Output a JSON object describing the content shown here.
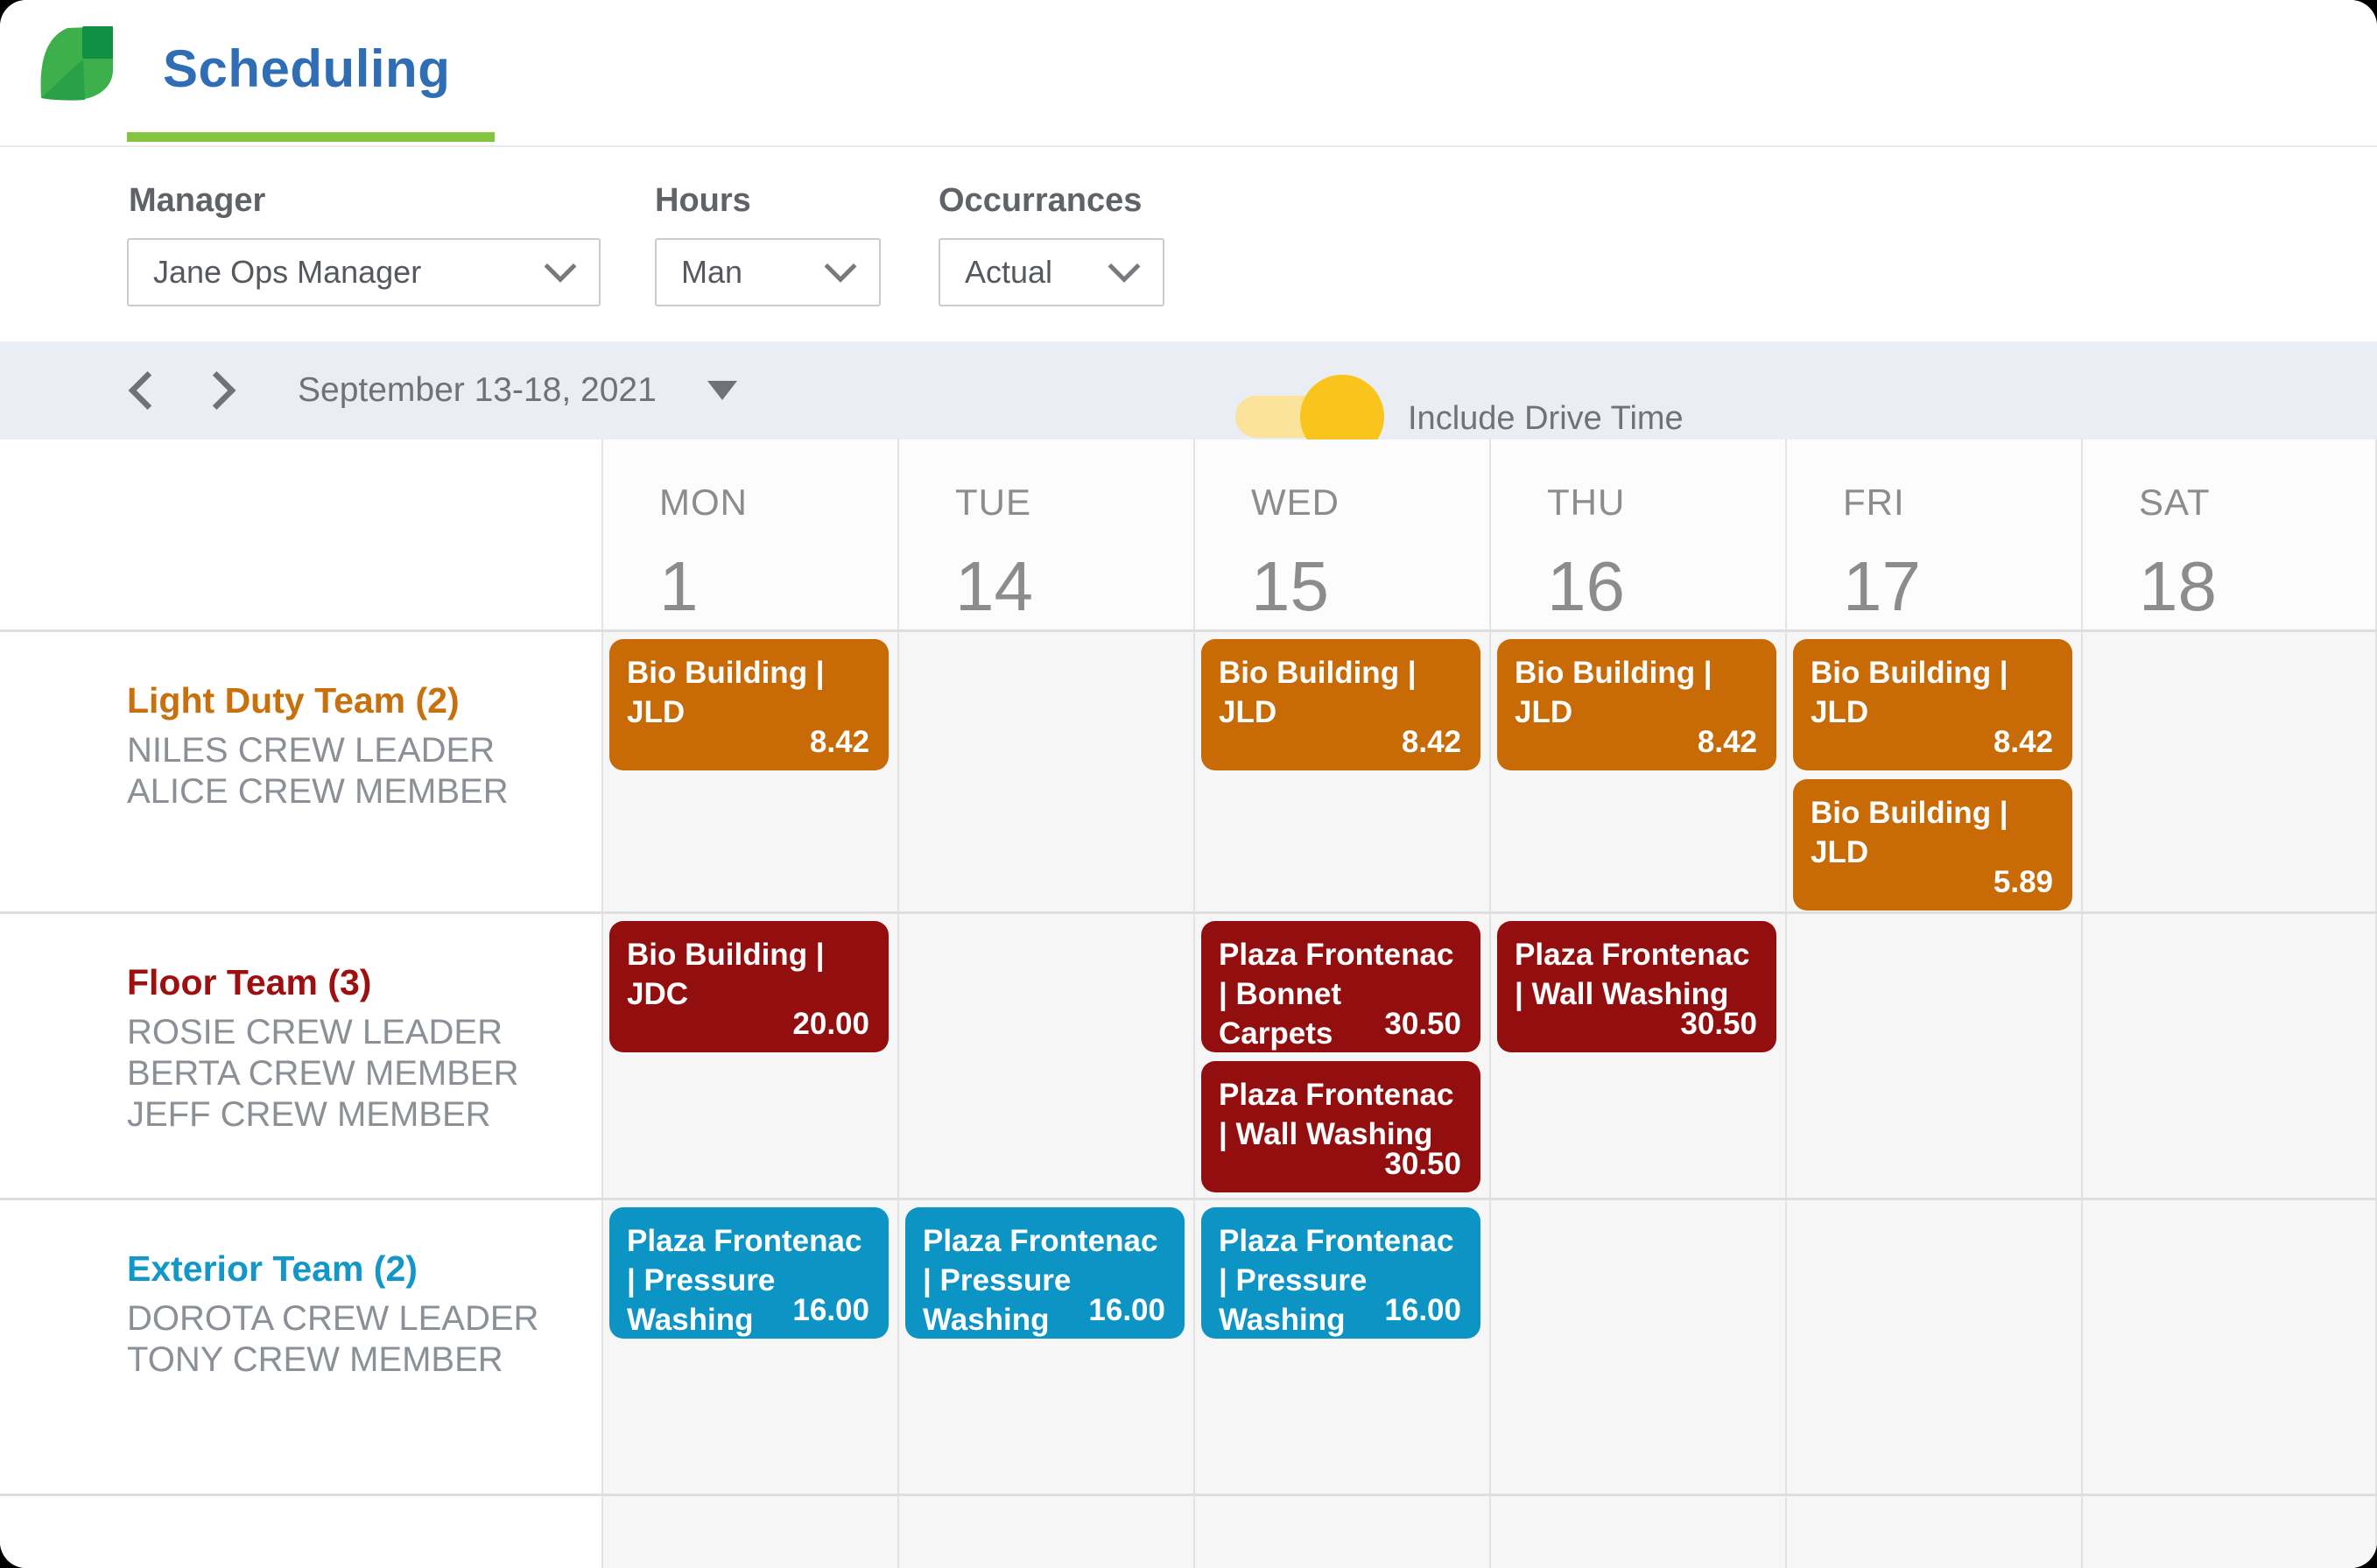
{
  "app": {
    "title": "Scheduling"
  },
  "filters": {
    "manager": {
      "label": "Manager",
      "value": "Jane Ops Manager"
    },
    "hours": {
      "label": "Hours",
      "value": "Man"
    },
    "occurrences": {
      "label": "Occurrances",
      "value": "Actual"
    },
    "drive_time": {
      "label": "Include Drive Time",
      "enabled": true
    }
  },
  "week_nav": {
    "range_label": "September 13-18, 2021"
  },
  "calendar": {
    "days": [
      {
        "name": "MON",
        "number": "1"
      },
      {
        "name": "TUE",
        "number": "14"
      },
      {
        "name": "WED",
        "number": "15"
      },
      {
        "name": "THU",
        "number": "16"
      },
      {
        "name": "FRI",
        "number": "17"
      },
      {
        "name": "SAT",
        "number": "18"
      }
    ],
    "teams": [
      {
        "name": "Light Duty Team (2)",
        "name_color": "#C8700C",
        "event_color": "#C86A06",
        "members": [
          "NILES CREW LEADER",
          "ALICE CREW MEMBER"
        ]
      },
      {
        "name": "Floor Team (3)",
        "name_color": "#9E1010",
        "event_color": "#930F0F",
        "members": [
          "ROSIE CREW LEADER",
          "BERTA CREW MEMBER",
          "JEFF CREW MEMBER"
        ]
      },
      {
        "name": "Exterior Team (2)",
        "name_color": "#1396C8",
        "event_color": "#0C94C4",
        "members": [
          "DOROTA CREW LEADER",
          "TONY CREW MEMBER"
        ]
      }
    ],
    "events": [
      {
        "team": 0,
        "day": 0,
        "slot": 0,
        "title": "Bio Building | JLD",
        "value": "8.42"
      },
      {
        "team": 0,
        "day": 2,
        "slot": 0,
        "title": "Bio Building | JLD",
        "value": "8.42"
      },
      {
        "team": 0,
        "day": 3,
        "slot": 0,
        "title": "Bio Building | JLD",
        "value": "8.42"
      },
      {
        "team": 0,
        "day": 4,
        "slot": 0,
        "title": "Bio Building | JLD",
        "value": "8.42"
      },
      {
        "team": 0,
        "day": 4,
        "slot": 1,
        "title": "Bio Building | JLD",
        "value": "5.89"
      },
      {
        "team": 1,
        "day": 0,
        "slot": 0,
        "title": "Bio Building | JDC",
        "value": "20.00"
      },
      {
        "team": 1,
        "day": 2,
        "slot": 0,
        "title": "Plaza Frontenac | Bonnet Carpets",
        "value": "30.50"
      },
      {
        "team": 1,
        "day": 2,
        "slot": 1,
        "title": "Plaza Frontenac | Wall Washing",
        "value": "30.50"
      },
      {
        "team": 1,
        "day": 3,
        "slot": 0,
        "title": "Plaza Frontenac | Wall Washing",
        "value": "30.50"
      },
      {
        "team": 2,
        "day": 0,
        "slot": 0,
        "title": "Plaza Frontenac | Pressure Washing",
        "value": "16.00"
      },
      {
        "team": 2,
        "day": 1,
        "slot": 0,
        "title": "Plaza Frontenac | Pressure Washing",
        "value": "16.00"
      },
      {
        "team": 2,
        "day": 2,
        "slot": 0,
        "title": "Plaza Frontenac | Pressure Washing",
        "value": "16.00"
      }
    ]
  },
  "colors": {
    "title_blue": "#2F6EB5",
    "underline_green": "#85C441",
    "logo_green_light": "#3DB04B",
    "logo_green_dark": "#0F9044",
    "toggle_track": "#FBE39B",
    "toggle_knob": "#F9C41B",
    "nav_bg": "#EAEDF4",
    "cell_bg": "#F6F6F7"
  }
}
